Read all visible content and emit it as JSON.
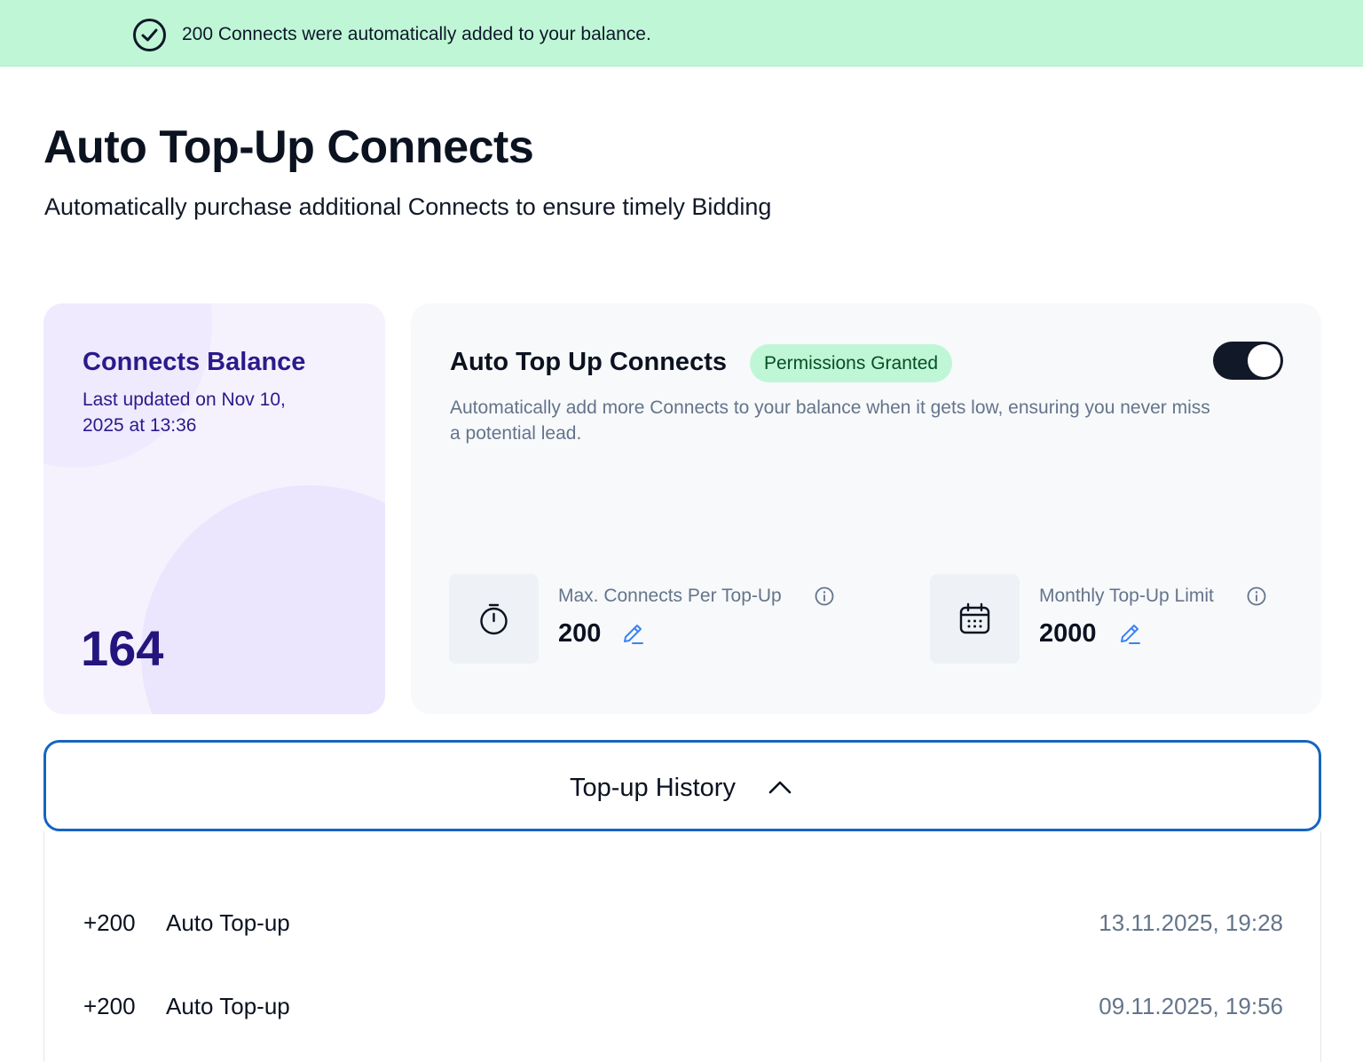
{
  "banner": {
    "icon": "check-circle-icon",
    "message": "200 Connects were automatically added to your balance.",
    "color": "#bff7d6"
  },
  "header": {
    "title": "Auto Top-Up Connects",
    "subtitle": "Automatically purchase additional Connects to ensure timely Bidding"
  },
  "balance_card": {
    "title": "Connects Balance",
    "last_updated": "Last updated on Nov 10, 2025 at 13:36",
    "value": "164",
    "accent": "#2a1a8c"
  },
  "auto_card": {
    "title": "Auto Top Up Connects",
    "badge": "Permissions Granted",
    "toggle_on": true,
    "description": "Automatically add more Connects to your balance when it gets low, ensuring you never miss a potential lead.",
    "max_per_topup": {
      "icon": "stopwatch-icon",
      "label": "Max. Connects Per Top-Up",
      "value": "200"
    },
    "monthly_limit": {
      "icon": "calendar-icon",
      "label": "Monthly Top-Up Limit",
      "value": "2000"
    }
  },
  "history": {
    "label": "Top-up History",
    "expanded": true,
    "rows": [
      {
        "amount": "+200",
        "type": "Auto Top-up",
        "date": "13.11.2025, 19:28"
      },
      {
        "amount": "+200",
        "type": "Auto Top-up",
        "date": "09.11.2025, 19:56"
      }
    ]
  }
}
